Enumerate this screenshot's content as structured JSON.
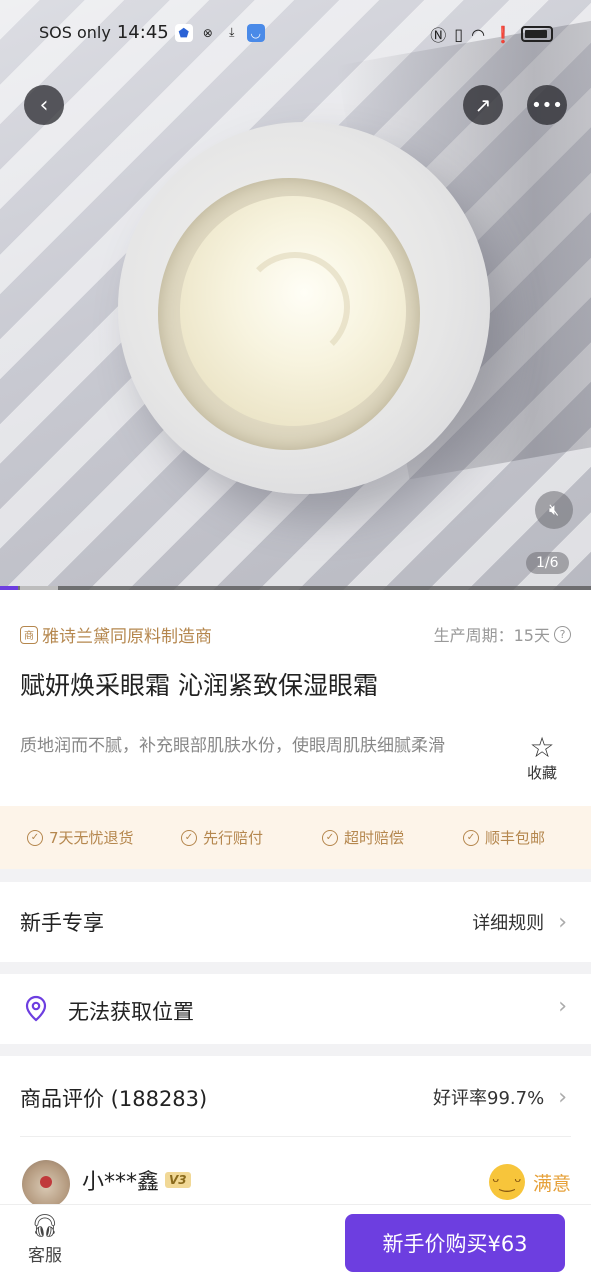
{
  "status_bar": {
    "carrier": "SOS only",
    "time": "14:45",
    "icons_left": [
      "shield-icon",
      "vpn-icon",
      "download-icon",
      "app-notification-icon"
    ],
    "icons_right": [
      "nfc-icon",
      "vibrate-icon",
      "wifi-icon",
      "alert-icon",
      "battery-icon"
    ]
  },
  "hero": {
    "page_indicator": "1/6",
    "progress_fraction": 0.166
  },
  "product": {
    "maker_badge_glyph": "商",
    "maker_label": "雅诗兰黛同原料制造商",
    "period_label": "生产周期：15天",
    "title": "赋妍焕采眼霜  沁润紧致保湿眼霜",
    "description": "质地润而不腻，补充眼部肌肤水份，使眼周肌肤细腻柔滑",
    "favorite_label": "收藏"
  },
  "guarantees": [
    "7天无忧退货",
    "先行赔付",
    "超时赔偿",
    "顺丰包邮"
  ],
  "newbie": {
    "label": "新手专享",
    "rule_link": "详细规则"
  },
  "location": {
    "label": "无法获取位置"
  },
  "reviews": {
    "label": "商品评价 (188283)",
    "good_rate": "好评率99.7%",
    "first": {
      "username": "小***鑫",
      "level": "V3",
      "rating": "满意"
    }
  },
  "bottom": {
    "service_label": "客服",
    "buy_label": "新手价购买¥63"
  },
  "colors": {
    "accent": "#6d3ee0",
    "gold": "#b5874e",
    "guarantee_bg": "#fdf4e9"
  }
}
